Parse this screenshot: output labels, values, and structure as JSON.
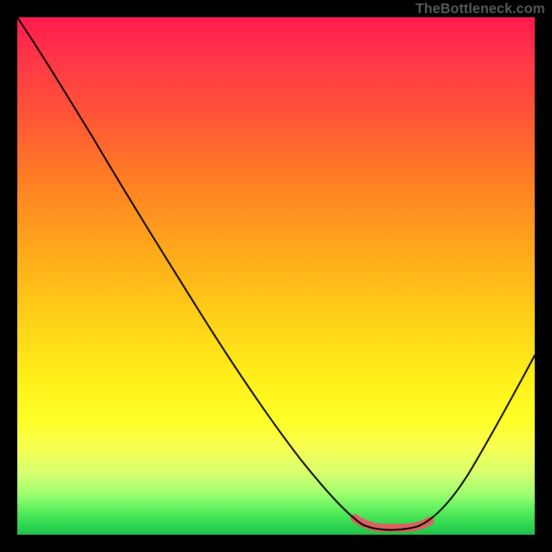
{
  "watermark": {
    "text": "TheBottleneck.com"
  },
  "colors": {
    "background": "#000000",
    "curve": "#000000",
    "accent": "#dd5f5f",
    "gradient_top": "#ff1a4d",
    "gradient_bottom": "#20c048"
  },
  "chart_data": {
    "type": "line",
    "title": "",
    "xlabel": "",
    "ylabel": "",
    "xlim": [
      0,
      100
    ],
    "ylim": [
      0,
      100
    ],
    "grid": false,
    "series": [
      {
        "name": "bottleneck-curve",
        "x": [
          0,
          6,
          12,
          18,
          24,
          30,
          36,
          42,
          48,
          54,
          58,
          62,
          66,
          70,
          74,
          78,
          82,
          86,
          90,
          94,
          100
        ],
        "y": [
          100,
          92,
          84,
          76,
          68,
          60,
          52,
          44,
          36,
          28,
          22,
          15,
          8,
          3,
          1,
          1,
          3,
          9,
          18,
          28,
          43
        ]
      }
    ],
    "annotations": [
      {
        "name": "valley-accent",
        "x_range": [
          66,
          80
        ],
        "y": 1
      }
    ]
  }
}
